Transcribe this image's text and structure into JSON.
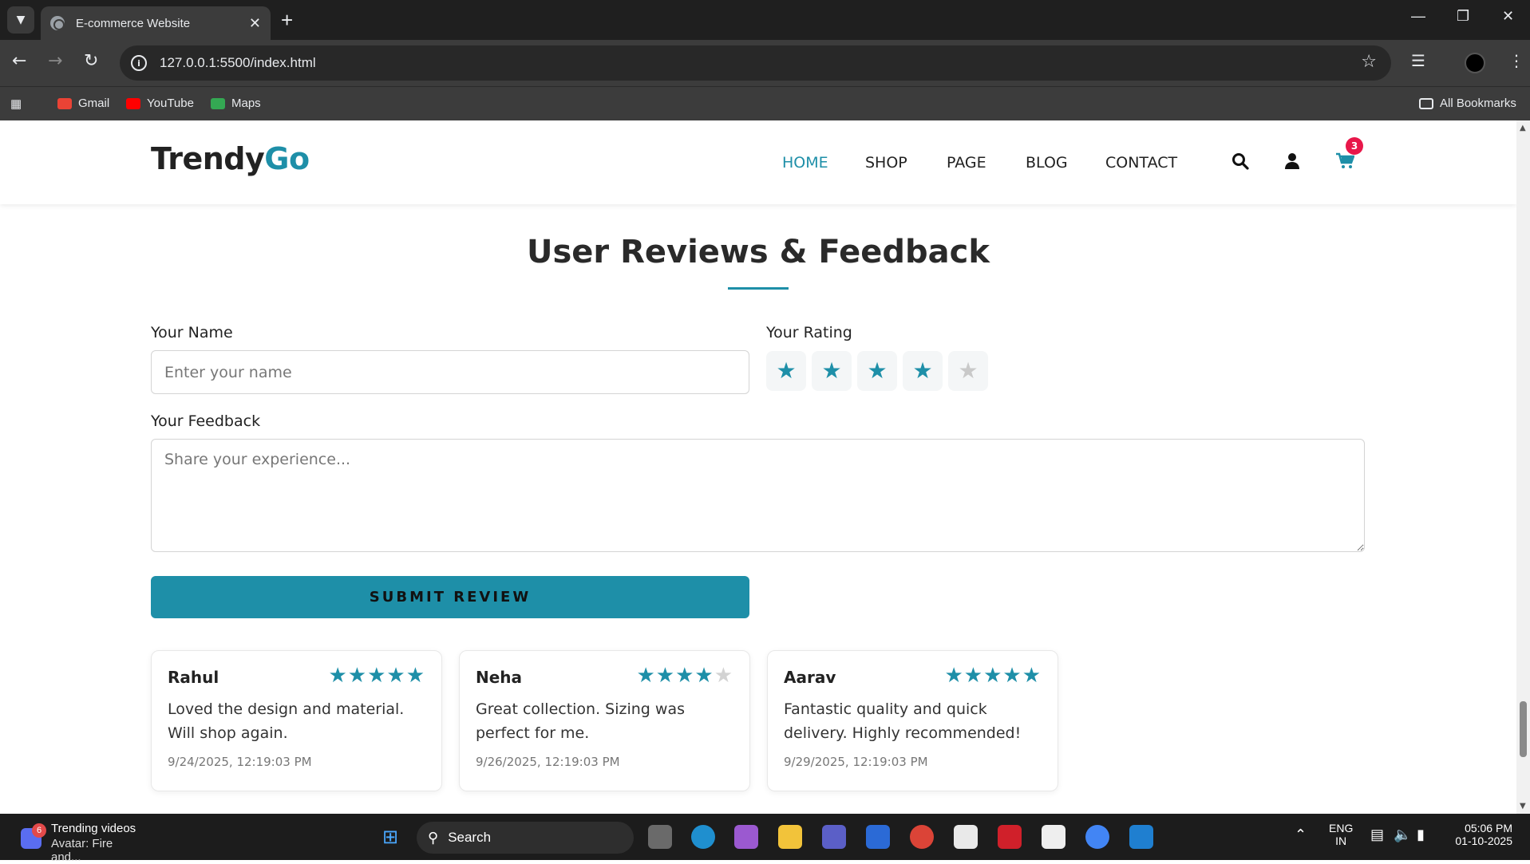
{
  "browser": {
    "tab_title": "E-commerce Website",
    "url": "127.0.0.1:5500/index.html",
    "bookmarks": [
      "Gmail",
      "YouTube",
      "Maps"
    ],
    "all_bookmarks": "All Bookmarks"
  },
  "site": {
    "logo_main": "Trendy",
    "logo_accent": "Go",
    "nav": [
      "HOME",
      "SHOP",
      "PAGE",
      "BLOG",
      "CONTACT"
    ],
    "active_nav": "HOME",
    "cart_count": "3",
    "accent_color": "#1e8fa8"
  },
  "reviews_section": {
    "title": "User Reviews & Feedback",
    "name_label": "Your Name",
    "name_placeholder": "Enter your name",
    "rating_label": "Your Rating",
    "rating_value": 4,
    "rating_max": 5,
    "feedback_label": "Your Feedback",
    "feedback_placeholder": "Share your experience...",
    "submit_label": "SUBMIT REVIEW",
    "reviews": [
      {
        "name": "Rahul",
        "rating": 5,
        "text": "Loved the design and material. Will shop again.",
        "date": "9/24/2025, 12:19:03 PM"
      },
      {
        "name": "Neha",
        "rating": 4,
        "text": "Great collection. Sizing was perfect for me.",
        "date": "9/26/2025, 12:19:03 PM"
      },
      {
        "name": "Aarav",
        "rating": 5,
        "text": "Fantastic quality and quick delivery. Highly recommended!",
        "date": "9/29/2025, 12:19:03 PM"
      }
    ]
  },
  "taskbar": {
    "news_title": "Trending videos",
    "news_sub": "Avatar: Fire and...",
    "news_badge": "6",
    "search_label": "Search",
    "lang_line1": "ENG",
    "lang_line2": "IN",
    "time": "05:06 PM",
    "date": "01-10-2025"
  }
}
